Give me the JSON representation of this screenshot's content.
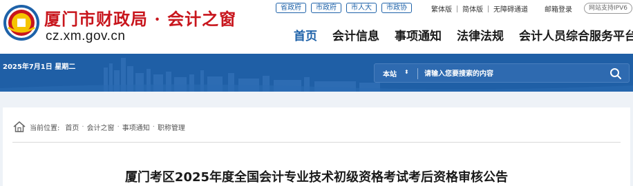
{
  "header": {
    "logo_title": "厦门市财政局 · 会计之窗",
    "logo_domain": "cz.xm.gov.cn",
    "site_links": [
      "省政府",
      "市政府",
      "市人大",
      "市政协"
    ],
    "util_links": {
      "traditional": "繁体版",
      "simplified": "简体版",
      "accessibility": "无障碍通道",
      "login": "邮箱登录"
    },
    "ipv6": "网站支持IPV6",
    "nav": [
      "首页",
      "会计信息",
      "事项通知",
      "法律法规",
      "会计人员综合服务平台"
    ]
  },
  "banner": {
    "date": "2025年7月1日 星期二",
    "search": {
      "scope": "本站",
      "placeholder": "请输入您要搜索的内容"
    }
  },
  "breadcrumb": {
    "prefix": "当前位置:",
    "items": [
      "首页",
      "会计之窗",
      "事项通知",
      "职称管理"
    ]
  },
  "article": {
    "title": "厦门考区2025年度全国会计专业技术初级资格考试考后资格审核公告"
  },
  "colors": {
    "brand_red": "#c8161d",
    "brand_blue": "#1e62a9",
    "banner_blue": "#1f5fa6"
  }
}
